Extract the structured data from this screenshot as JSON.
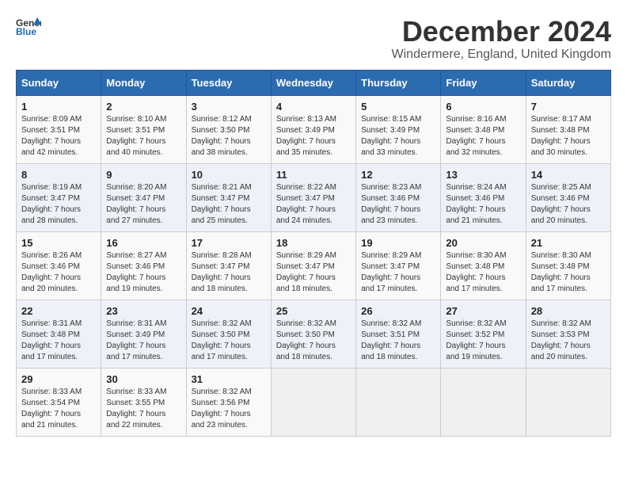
{
  "logo": {
    "line1": "General",
    "line2": "Blue"
  },
  "title": "December 2024",
  "subtitle": "Windermere, England, United Kingdom",
  "days_of_week": [
    "Sunday",
    "Monday",
    "Tuesday",
    "Wednesday",
    "Thursday",
    "Friday",
    "Saturday"
  ],
  "weeks": [
    [
      {
        "day": "1",
        "sunrise": "Sunrise: 8:09 AM",
        "sunset": "Sunset: 3:51 PM",
        "daylight": "Daylight: 7 hours and 42 minutes."
      },
      {
        "day": "2",
        "sunrise": "Sunrise: 8:10 AM",
        "sunset": "Sunset: 3:51 PM",
        "daylight": "Daylight: 7 hours and 40 minutes."
      },
      {
        "day": "3",
        "sunrise": "Sunrise: 8:12 AM",
        "sunset": "Sunset: 3:50 PM",
        "daylight": "Daylight: 7 hours and 38 minutes."
      },
      {
        "day": "4",
        "sunrise": "Sunrise: 8:13 AM",
        "sunset": "Sunset: 3:49 PM",
        "daylight": "Daylight: 7 hours and 35 minutes."
      },
      {
        "day": "5",
        "sunrise": "Sunrise: 8:15 AM",
        "sunset": "Sunset: 3:49 PM",
        "daylight": "Daylight: 7 hours and 33 minutes."
      },
      {
        "day": "6",
        "sunrise": "Sunrise: 8:16 AM",
        "sunset": "Sunset: 3:48 PM",
        "daylight": "Daylight: 7 hours and 32 minutes."
      },
      {
        "day": "7",
        "sunrise": "Sunrise: 8:17 AM",
        "sunset": "Sunset: 3:48 PM",
        "daylight": "Daylight: 7 hours and 30 minutes."
      }
    ],
    [
      {
        "day": "8",
        "sunrise": "Sunrise: 8:19 AM",
        "sunset": "Sunset: 3:47 PM",
        "daylight": "Daylight: 7 hours and 28 minutes."
      },
      {
        "day": "9",
        "sunrise": "Sunrise: 8:20 AM",
        "sunset": "Sunset: 3:47 PM",
        "daylight": "Daylight: 7 hours and 27 minutes."
      },
      {
        "day": "10",
        "sunrise": "Sunrise: 8:21 AM",
        "sunset": "Sunset: 3:47 PM",
        "daylight": "Daylight: 7 hours and 25 minutes."
      },
      {
        "day": "11",
        "sunrise": "Sunrise: 8:22 AM",
        "sunset": "Sunset: 3:47 PM",
        "daylight": "Daylight: 7 hours and 24 minutes."
      },
      {
        "day": "12",
        "sunrise": "Sunrise: 8:23 AM",
        "sunset": "Sunset: 3:46 PM",
        "daylight": "Daylight: 7 hours and 23 minutes."
      },
      {
        "day": "13",
        "sunrise": "Sunrise: 8:24 AM",
        "sunset": "Sunset: 3:46 PM",
        "daylight": "Daylight: 7 hours and 21 minutes."
      },
      {
        "day": "14",
        "sunrise": "Sunrise: 8:25 AM",
        "sunset": "Sunset: 3:46 PM",
        "daylight": "Daylight: 7 hours and 20 minutes."
      }
    ],
    [
      {
        "day": "15",
        "sunrise": "Sunrise: 8:26 AM",
        "sunset": "Sunset: 3:46 PM",
        "daylight": "Daylight: 7 hours and 20 minutes."
      },
      {
        "day": "16",
        "sunrise": "Sunrise: 8:27 AM",
        "sunset": "Sunset: 3:46 PM",
        "daylight": "Daylight: 7 hours and 19 minutes."
      },
      {
        "day": "17",
        "sunrise": "Sunrise: 8:28 AM",
        "sunset": "Sunset: 3:47 PM",
        "daylight": "Daylight: 7 hours and 18 minutes."
      },
      {
        "day": "18",
        "sunrise": "Sunrise: 8:29 AM",
        "sunset": "Sunset: 3:47 PM",
        "daylight": "Daylight: 7 hours and 18 minutes."
      },
      {
        "day": "19",
        "sunrise": "Sunrise: 8:29 AM",
        "sunset": "Sunset: 3:47 PM",
        "daylight": "Daylight: 7 hours and 17 minutes."
      },
      {
        "day": "20",
        "sunrise": "Sunrise: 8:30 AM",
        "sunset": "Sunset: 3:48 PM",
        "daylight": "Daylight: 7 hours and 17 minutes."
      },
      {
        "day": "21",
        "sunrise": "Sunrise: 8:30 AM",
        "sunset": "Sunset: 3:48 PM",
        "daylight": "Daylight: 7 hours and 17 minutes."
      }
    ],
    [
      {
        "day": "22",
        "sunrise": "Sunrise: 8:31 AM",
        "sunset": "Sunset: 3:48 PM",
        "daylight": "Daylight: 7 hours and 17 minutes."
      },
      {
        "day": "23",
        "sunrise": "Sunrise: 8:31 AM",
        "sunset": "Sunset: 3:49 PM",
        "daylight": "Daylight: 7 hours and 17 minutes."
      },
      {
        "day": "24",
        "sunrise": "Sunrise: 8:32 AM",
        "sunset": "Sunset: 3:50 PM",
        "daylight": "Daylight: 7 hours and 17 minutes."
      },
      {
        "day": "25",
        "sunrise": "Sunrise: 8:32 AM",
        "sunset": "Sunset: 3:50 PM",
        "daylight": "Daylight: 7 hours and 18 minutes."
      },
      {
        "day": "26",
        "sunrise": "Sunrise: 8:32 AM",
        "sunset": "Sunset: 3:51 PM",
        "daylight": "Daylight: 7 hours and 18 minutes."
      },
      {
        "day": "27",
        "sunrise": "Sunrise: 8:32 AM",
        "sunset": "Sunset: 3:52 PM",
        "daylight": "Daylight: 7 hours and 19 minutes."
      },
      {
        "day": "28",
        "sunrise": "Sunrise: 8:32 AM",
        "sunset": "Sunset: 3:53 PM",
        "daylight": "Daylight: 7 hours and 20 minutes."
      }
    ],
    [
      {
        "day": "29",
        "sunrise": "Sunrise: 8:33 AM",
        "sunset": "Sunset: 3:54 PM",
        "daylight": "Daylight: 7 hours and 21 minutes."
      },
      {
        "day": "30",
        "sunrise": "Sunrise: 8:33 AM",
        "sunset": "Sunset: 3:55 PM",
        "daylight": "Daylight: 7 hours and 22 minutes."
      },
      {
        "day": "31",
        "sunrise": "Sunrise: 8:32 AM",
        "sunset": "Sunset: 3:56 PM",
        "daylight": "Daylight: 7 hours and 23 minutes."
      },
      null,
      null,
      null,
      null
    ]
  ]
}
